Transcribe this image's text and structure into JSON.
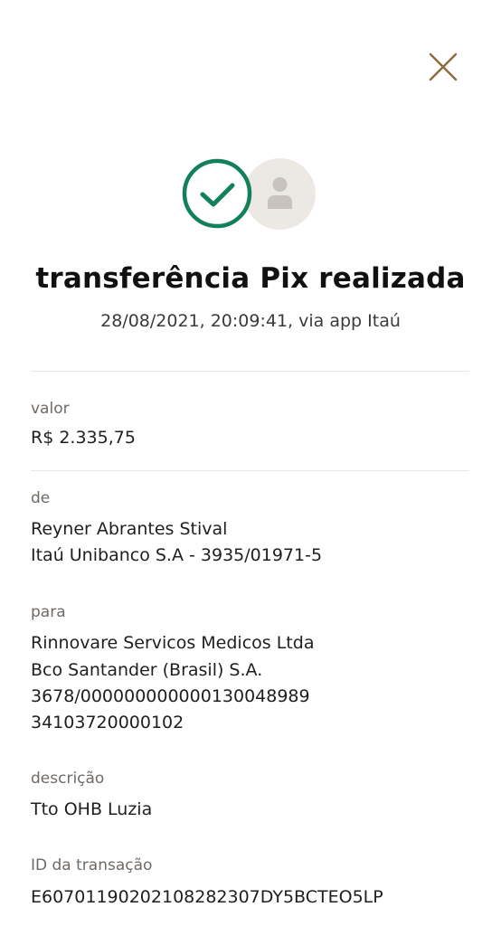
{
  "header": {
    "close_icon": "close-icon",
    "accent_color": "#8c6a3a"
  },
  "status": {
    "success_icon": "check-circle-icon",
    "success_color": "#12815a",
    "avatar_icon": "person-icon",
    "title": "transferência Pix realizada",
    "subtitle": "28/08/2021, 20:09:41, via app Itaú"
  },
  "details": {
    "valor": {
      "label": "valor",
      "value": "R$ 2.335,75"
    },
    "de": {
      "label": "de",
      "lines": [
        "Reyner Abrantes Stival",
        "Itaú Unibanco S.A - 3935/01971-5"
      ]
    },
    "para": {
      "label": "para",
      "lines": [
        "Rinnovare Servicos Medicos Ltda",
        "Bco Santander (Brasil) S.A.",
        "3678/000000000000130048989",
        "34103720000102"
      ]
    },
    "descricao": {
      "label": "descrição",
      "value": "Tto OHB Luzia"
    },
    "id_transacao": {
      "label": "ID da transação",
      "value": "E60701190202108282307DY5BCTEO5LP"
    }
  }
}
